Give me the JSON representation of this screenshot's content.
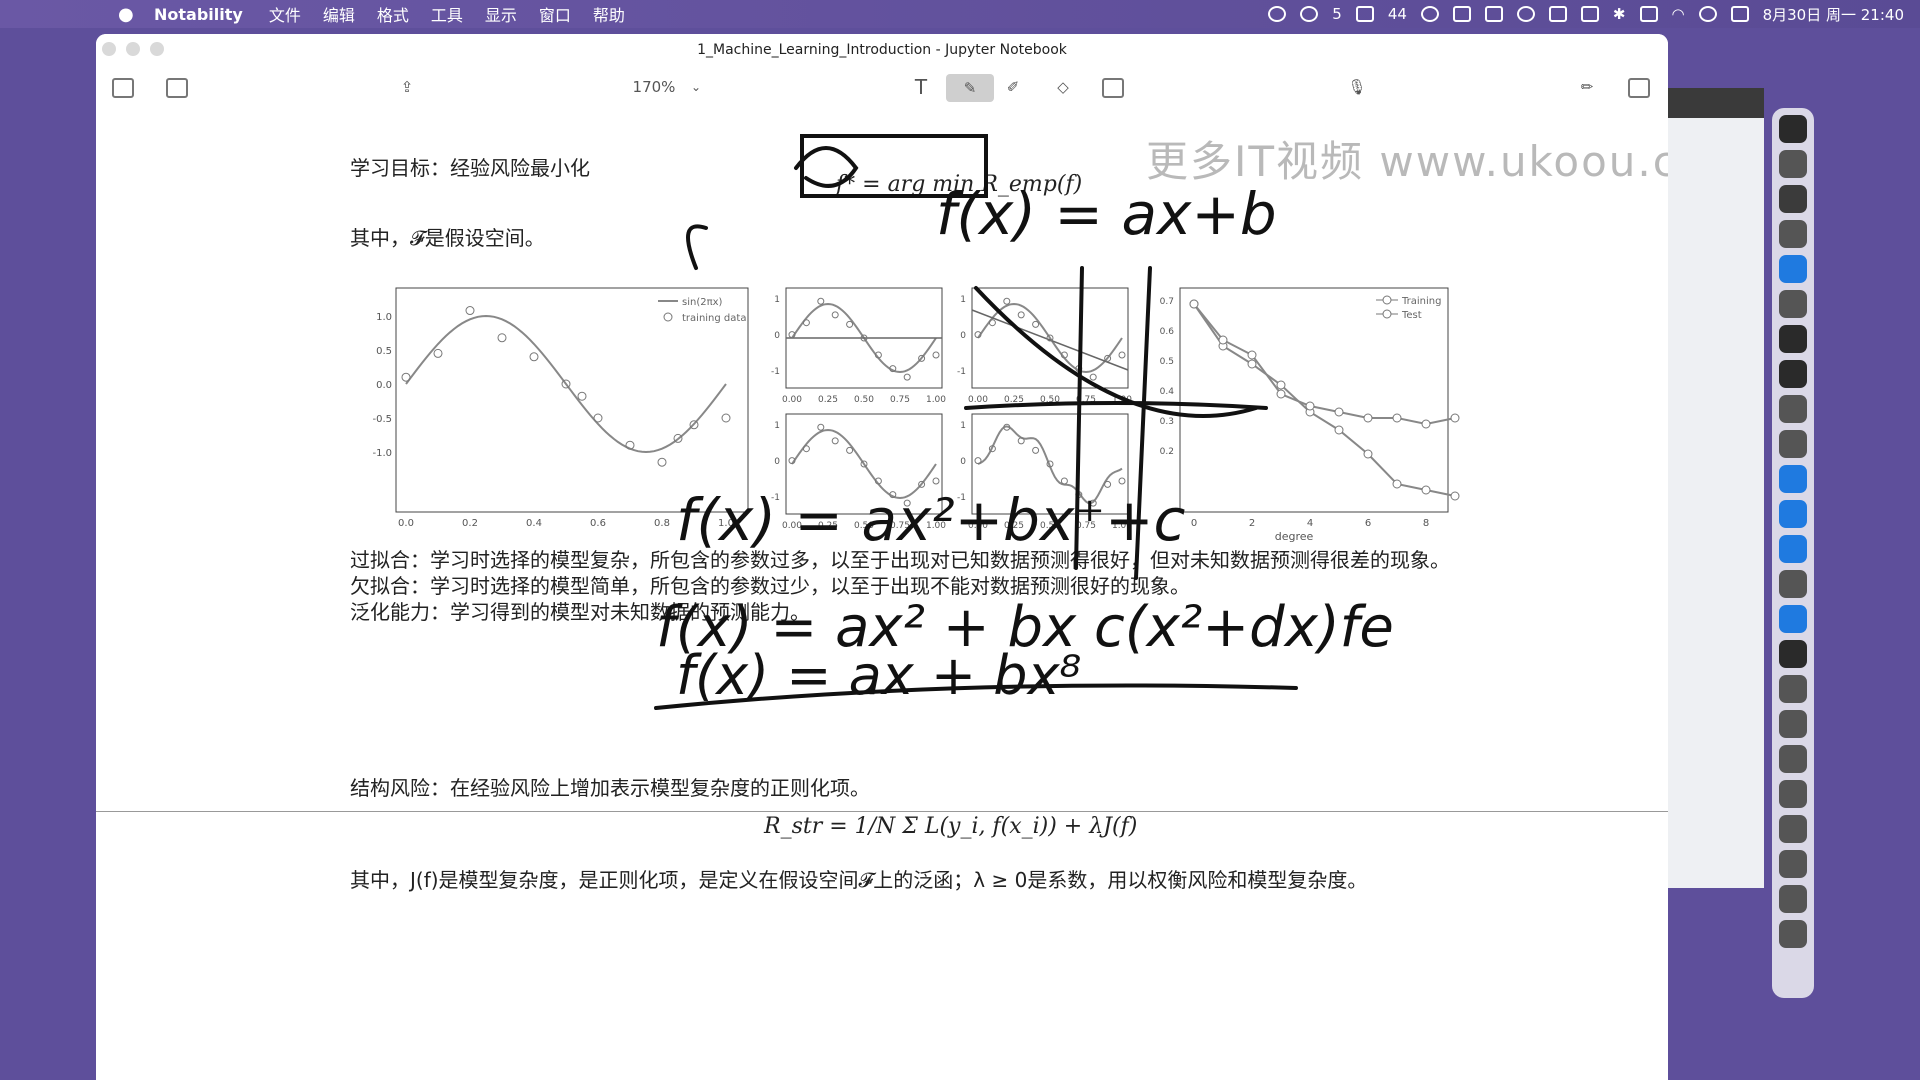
{
  "menubar": {
    "app_name": "Notability",
    "items": [
      "文件",
      "编辑",
      "格式",
      "工具",
      "显示",
      "窗口",
      "帮助"
    ],
    "wechat_count": "5",
    "battery": "44",
    "datetime": "8月30日 周一 21:40"
  },
  "window": {
    "title": "1_Machine_Learning_Introduction - Jupyter Notebook",
    "zoom": "170%"
  },
  "watermark": "更多IT视频  www.ukoou.com",
  "notebook": {
    "goal_label": "学习目标：经验风险最小化",
    "goal_formula": "f* = arg min R_emp(f)",
    "where_F": "其中，𝓕是假设空间。",
    "overfit": "过拟合：学习时选择的模型复杂，所包含的参数过多，以至于出现对已知数据预测得很好，但对未知数据预测得很差的现象。",
    "underfit": "欠拟合：学习时选择的模型简单，所包含的参数过少，以至于出现不能对数据预测很好的现象。",
    "generalization": "泛化能力：学习得到的模型对未知数据的预测能力。",
    "struct_risk": "结构风险：在经验风险上增加表示模型复杂度的正则化项。",
    "struct_formula": "R_str = 1/N Σ L(y_i, f(x_i)) + λJ(f)",
    "struct_where": "其中，J(f)是模型复杂度，是正则化项，是定义在假设空间𝓕上的泛函；λ ≥ 0是系数，用以权衡风险和模型复杂度。"
  },
  "plots": {
    "main_legend": [
      "sin(2πx)",
      "training data"
    ],
    "main_yticks": [
      "1.0",
      "0.5",
      "0.0",
      "-0.5",
      "-1.0"
    ],
    "main_xticks": [
      "0.0",
      "0.2",
      "0.4",
      "0.6",
      "0.8",
      "1.0"
    ],
    "small_xticks": [
      "0.00",
      "0.25",
      "0.50",
      "0.75",
      "1.00"
    ],
    "small_yticks": [
      "1",
      "0",
      "-1"
    ],
    "err_legend": [
      "Training",
      "Test"
    ],
    "err_xlabel": "degree",
    "err_yticks": [
      "0.7",
      "0.6",
      "0.5",
      "0.4",
      "0.3",
      "0.2"
    ],
    "err_xticks": [
      "0",
      "2",
      "4",
      "6",
      "8"
    ]
  },
  "handwriting": {
    "l1": "f(x) = ax+b",
    "l2": "f(x) = ax²+bx⁺+c",
    "l3": "f(x) = ax² + bx  c(x²+dx)fe",
    "l4": "f(x) = ax + bx⁸"
  }
}
